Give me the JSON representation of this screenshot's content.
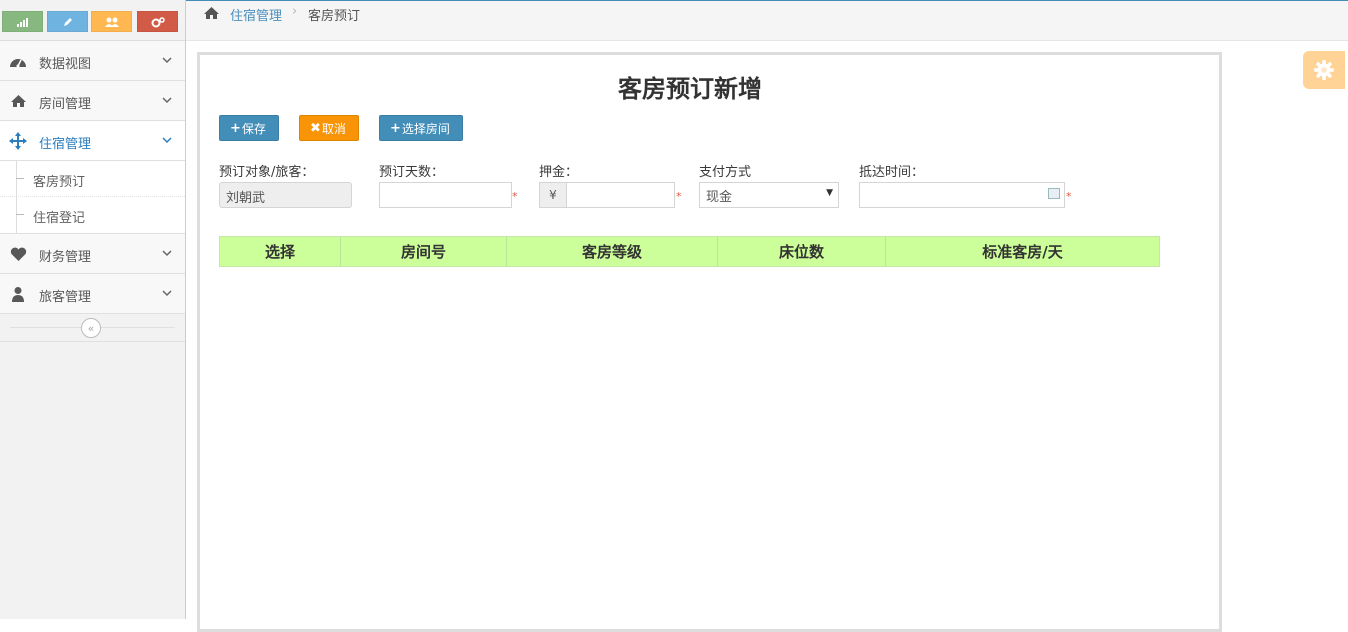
{
  "shortcuts": [
    {
      "name": "stats",
      "color": "#87b87f"
    },
    {
      "name": "edit",
      "color": "#6fb3e0"
    },
    {
      "name": "users",
      "color": "#ffb752"
    },
    {
      "name": "settings",
      "color": "#d15b47"
    }
  ],
  "sidebar": {
    "items": [
      {
        "label": "数据视图",
        "icon": "dashboard-icon"
      },
      {
        "label": "房间管理",
        "icon": "home-icon"
      },
      {
        "label": "住宿管理",
        "icon": "move-icon",
        "active": true
      },
      {
        "label": "财务管理",
        "icon": "heart-icon"
      },
      {
        "label": "旅客管理",
        "icon": "user-icon"
      }
    ],
    "subitems": [
      {
        "label": "客房预订"
      },
      {
        "label": "住宿登记"
      }
    ],
    "collapse_glyph": "«"
  },
  "breadcrumb": {
    "parent": "住宿管理",
    "separator": "›",
    "current": "客房预订"
  },
  "form": {
    "title": "客房预订新增",
    "buttons": {
      "save": "保存",
      "cancel": "取消",
      "select_room": "选择房间"
    },
    "labels": {
      "guest": "预订对象/旅客：",
      "days": "预订天数：",
      "deposit": "押金：",
      "payment": "支付方式",
      "arrival": "抵达时间："
    },
    "values": {
      "guest": "刘朝武",
      "days": "",
      "deposit": "",
      "payment": "现金",
      "arrival": ""
    },
    "currency": "¥",
    "required_mark": "*"
  },
  "table": {
    "headers": [
      "选择",
      "房间号",
      "客房等级",
      "床位数",
      "标准客房/天"
    ]
  },
  "colors": {
    "accent": "#438eb9",
    "warning": "#f89406",
    "grid_header": "#ccff99"
  }
}
